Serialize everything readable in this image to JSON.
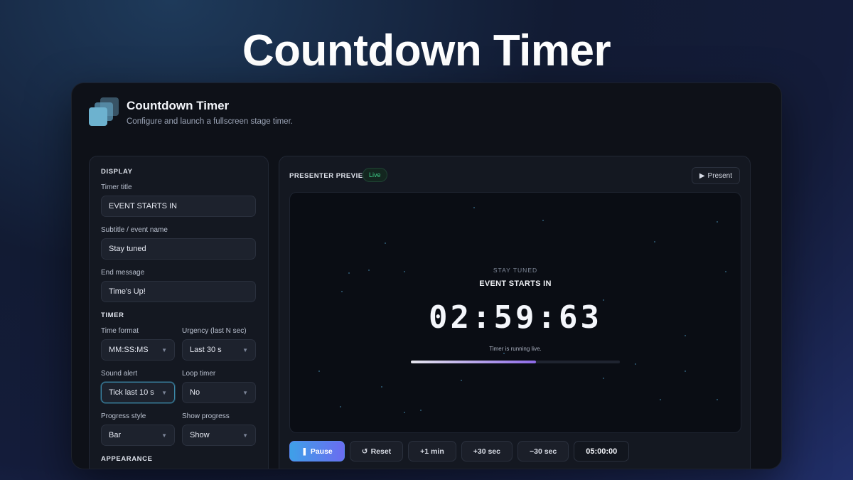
{
  "hero": {
    "title": "Countdown Timer"
  },
  "app": {
    "title": "Countdown Timer",
    "subtitle": "Configure and launch a fullscreen stage timer."
  },
  "settings": {
    "display": {
      "heading": "DISPLAY",
      "timer_title_label": "Timer title",
      "timer_title_value": "EVENT STARTS IN",
      "subtitle_label": "Subtitle / event name",
      "subtitle_value": "Stay tuned",
      "end_message_label": "End message",
      "end_message_value": "Time's Up!"
    },
    "timer": {
      "heading": "TIMER",
      "time_format_label": "Time format",
      "time_format_value": "MM:SS:MS",
      "urgency_label": "Urgency (last N sec)",
      "urgency_value": "Last 30 s",
      "sound_alert_label": "Sound alert",
      "sound_alert_value": "Tick last 10 s",
      "loop_timer_label": "Loop timer",
      "loop_timer_value": "No",
      "progress_style_label": "Progress style",
      "progress_style_value": "Bar",
      "show_progress_label": "Show progress",
      "show_progress_value": "Show"
    },
    "appearance": {
      "heading": "APPEARANCE"
    }
  },
  "preview": {
    "heading": "PRESENTER PREVIEW",
    "badge": "Live",
    "present_label": "Present",
    "stage": {
      "subtitle": "STAY TUNED",
      "title": "EVENT STARTS IN",
      "clock": "02:59:63",
      "status": "Timer is running live.",
      "progress_fraction": 0.6
    },
    "controls": {
      "pause": "Pause",
      "reset": "Reset",
      "plus_min": "+1 min",
      "plus_30": "+30 sec",
      "minus_30": "−30 sec",
      "duration": "05:00:00"
    }
  },
  "icons": {
    "logo": "stacked-squares-icon",
    "present": "play-icon",
    "pause": "pause-icon",
    "reset": "reset-icon",
    "chevron": "chevron-down-icon"
  },
  "colors": {
    "accent_start": "#3ea0e8",
    "accent_end": "#6b6cf0",
    "live_green": "#3fd18a"
  }
}
